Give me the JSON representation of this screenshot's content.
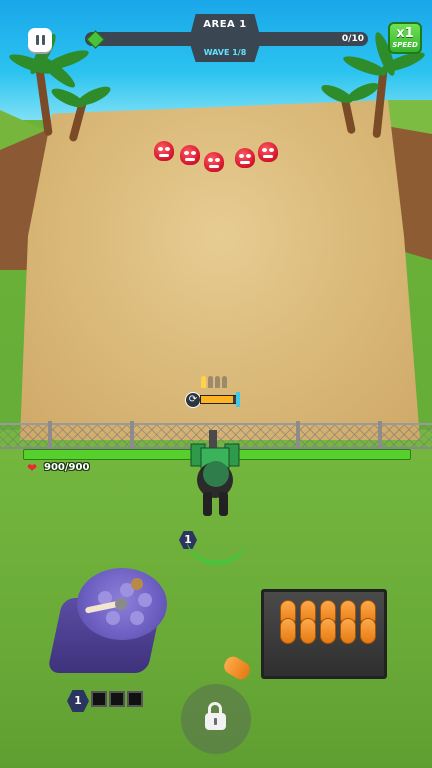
{
  "hud": {
    "area_title": "AREA 1",
    "wave_label": "WAVE 1/8",
    "progress_count": "0/10",
    "progress_value": 0,
    "speed_multiplier": "x1",
    "speed_word": "SPEED"
  },
  "barrier": {
    "hp_text": "900/900",
    "hp_fraction": 1.0
  },
  "weapon": {
    "ammo_total": 4,
    "ammo_loaded": 1,
    "reload_fraction": 0.9
  },
  "player": {
    "level": "1"
  },
  "turret_station": {
    "level": "1",
    "slots_total": 3,
    "slots_filled": 0
  },
  "enemies": {
    "count_visible": 5,
    "color": "#d4142b"
  },
  "colors": {
    "hud_dark": "#3a4752",
    "hp_green": "#56d12b",
    "speed_green": "#34b22d",
    "wave_cyan": "#63e0ff",
    "barrel_orange": "#e57a12",
    "turret_purple": "#6d5fc2"
  },
  "icons": {
    "pause": "pause-icon",
    "gem": "gem-icon",
    "heart": "heart-icon",
    "reload": "reload-icon",
    "lock": "lock-icon"
  }
}
